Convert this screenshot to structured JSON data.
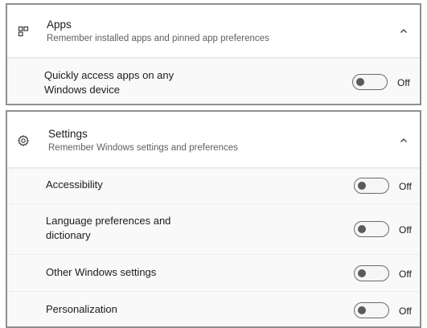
{
  "apps": {
    "title": "Apps",
    "subtitle": "Remember installed apps and pinned app preferences",
    "items": [
      {
        "label_line1": "Quickly access apps on any",
        "label_line2": "Windows device",
        "state": "Off"
      }
    ]
  },
  "settings": {
    "title": "Settings",
    "subtitle": "Remember Windows settings and preferences",
    "items": [
      {
        "label_line1": "Accessibility",
        "label_line2": "",
        "state": "Off"
      },
      {
        "label_line1": "Language preferences and",
        "label_line2": "dictionary",
        "state": "Off"
      },
      {
        "label_line1": "Other Windows settings",
        "label_line2": "",
        "state": "Off"
      },
      {
        "label_line1": "Personalization",
        "label_line2": "",
        "state": "Off"
      }
    ]
  },
  "icons": {
    "apps": "apps-grid-icon",
    "settings": "gear-icon",
    "collapse": "chevron-up-icon"
  },
  "colors": {
    "panel_border": "#8f8f8f",
    "toggle_border": "#6b6b6b",
    "toggle_knob": "#5a5a5a"
  }
}
